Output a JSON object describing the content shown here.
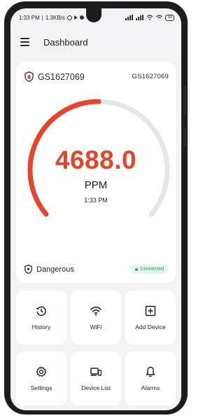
{
  "status_bar": {
    "time": "1:33 PM",
    "speed": "1.3KB/s",
    "battery": "33"
  },
  "header": {
    "title": "Dashboard"
  },
  "device": {
    "name": "GS1627069",
    "id": "GS1627069",
    "reading": "4688.0",
    "unit": "PPM",
    "time": "1:33 PM",
    "gauge_fraction": 0.5,
    "status": "Dangerous",
    "connection": "Connected"
  },
  "colors": {
    "accent": "#e8442a",
    "track": "#e6e6e6",
    "connected": "#2fae5f"
  },
  "tiles": [
    {
      "label": "History",
      "icon": "history-icon"
    },
    {
      "label": "WiFi",
      "icon": "wifi-icon"
    },
    {
      "label": "Add Device",
      "icon": "add-box-icon"
    },
    {
      "label": "Settings",
      "icon": "settings-icon"
    },
    {
      "label": "Device List",
      "icon": "device-list-icon"
    },
    {
      "label": "Alarms",
      "icon": "bell-icon"
    }
  ]
}
